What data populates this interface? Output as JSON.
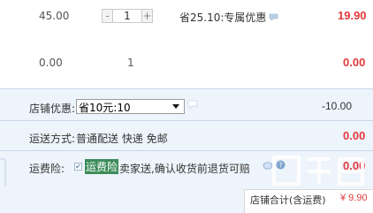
{
  "item1": {
    "price": "45.00",
    "qty_minus": "-",
    "qty_value": "1",
    "qty_plus": "+",
    "promo": "省25.10:专属优惠",
    "subtotal": "19.90"
  },
  "item2": {
    "price": "0.00",
    "qty": "1",
    "subtotal": "0.00"
  },
  "shop_discount": {
    "label": "店铺优惠:",
    "selected": "省10元:10",
    "amount": "-10.00"
  },
  "shipping": {
    "label": "运送方式:",
    "method": "普通配送 快递 免邮",
    "amount": "0.00"
  },
  "insurance": {
    "label": "运费险:",
    "checked_mark": "✔",
    "highlight": "运费险",
    "desc": "卖家送,确认收货前退货可赔",
    "amount": "0.00"
  },
  "total": {
    "label": "店铺合计(含运费)",
    "amount": "¥ 9.90"
  },
  "colors": {
    "red": "#e4393c",
    "panel": "#eef4fb",
    "highlight": "#3c8c5a"
  }
}
